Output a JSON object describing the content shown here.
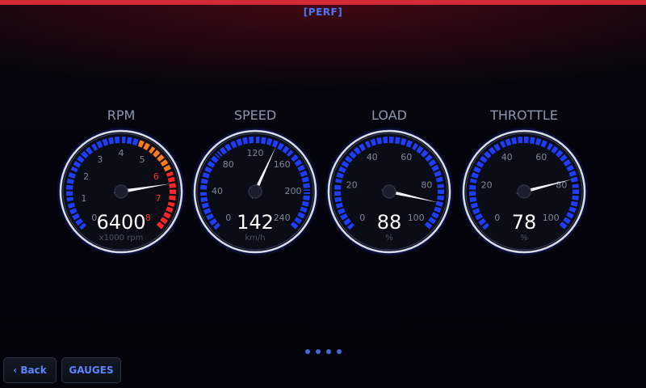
{
  "header": {
    "mode_label": "[PERF]",
    "accent_color": "#d42a36"
  },
  "gauges": [
    {
      "id": "rpm",
      "title": "RPM",
      "value_text": "6400",
      "unit": "x1000 rpm",
      "value": 6.4,
      "min": 0,
      "max": 8,
      "ticks": [
        "0",
        "1",
        "2",
        "3",
        "4",
        "5",
        "6",
        "7",
        "8"
      ],
      "redline_from": 6,
      "orange_from": 4.6,
      "arc_color": "#1f3dff",
      "redline_color": "#ff2626",
      "orange_color": "#ff7a1a"
    },
    {
      "id": "speed",
      "title": "SPEED",
      "value_text": "142",
      "unit": "km/h",
      "value": 142,
      "min": 0,
      "max": 240,
      "ticks": [
        "0",
        "40",
        "80",
        "120",
        "160",
        "200",
        "240"
      ],
      "arc_color": "#1f3dff"
    },
    {
      "id": "load",
      "title": "LOAD",
      "value_text": "88",
      "unit": "%",
      "value": 88,
      "min": 0,
      "max": 100,
      "ticks": [
        "0",
        "20",
        "40",
        "60",
        "80",
        "100"
      ],
      "arc_color": "#1f3dff"
    },
    {
      "id": "throttle",
      "title": "THROTTLE",
      "value_text": "78",
      "unit": "%",
      "value": 78,
      "min": 0,
      "max": 100,
      "ticks": [
        "0",
        "20",
        "40",
        "60",
        "80",
        "100"
      ],
      "arc_color": "#1f3dff"
    }
  ],
  "pager": {
    "page_count": 4
  },
  "footer": {
    "back_label": "‹ Back",
    "gauges_label": "GAUGES"
  }
}
